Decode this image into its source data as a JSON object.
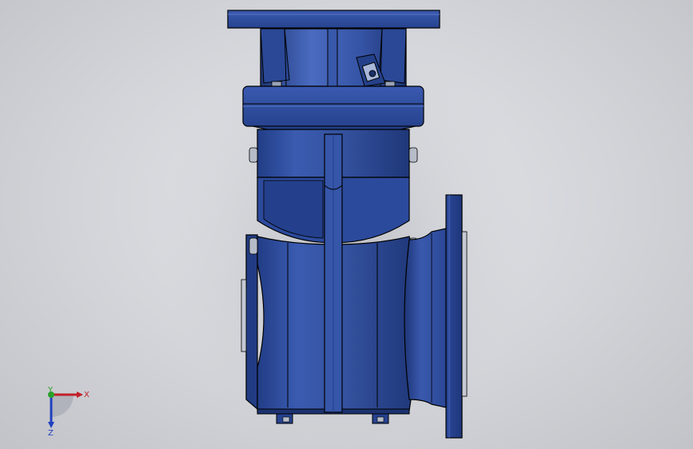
{
  "viewport": {
    "background": "#d6d7db"
  },
  "model": {
    "name": "gear-reducer-assembly",
    "body_color": "#2f4f9e",
    "dark_color": "#1d3577",
    "light_color": "#4d6cbd"
  },
  "triad": {
    "x_label": "X",
    "y_label": "Y",
    "z_label": "Z",
    "x_color": "#c0202a",
    "y_color": "#2aa02a",
    "z_color": "#2040c0"
  }
}
